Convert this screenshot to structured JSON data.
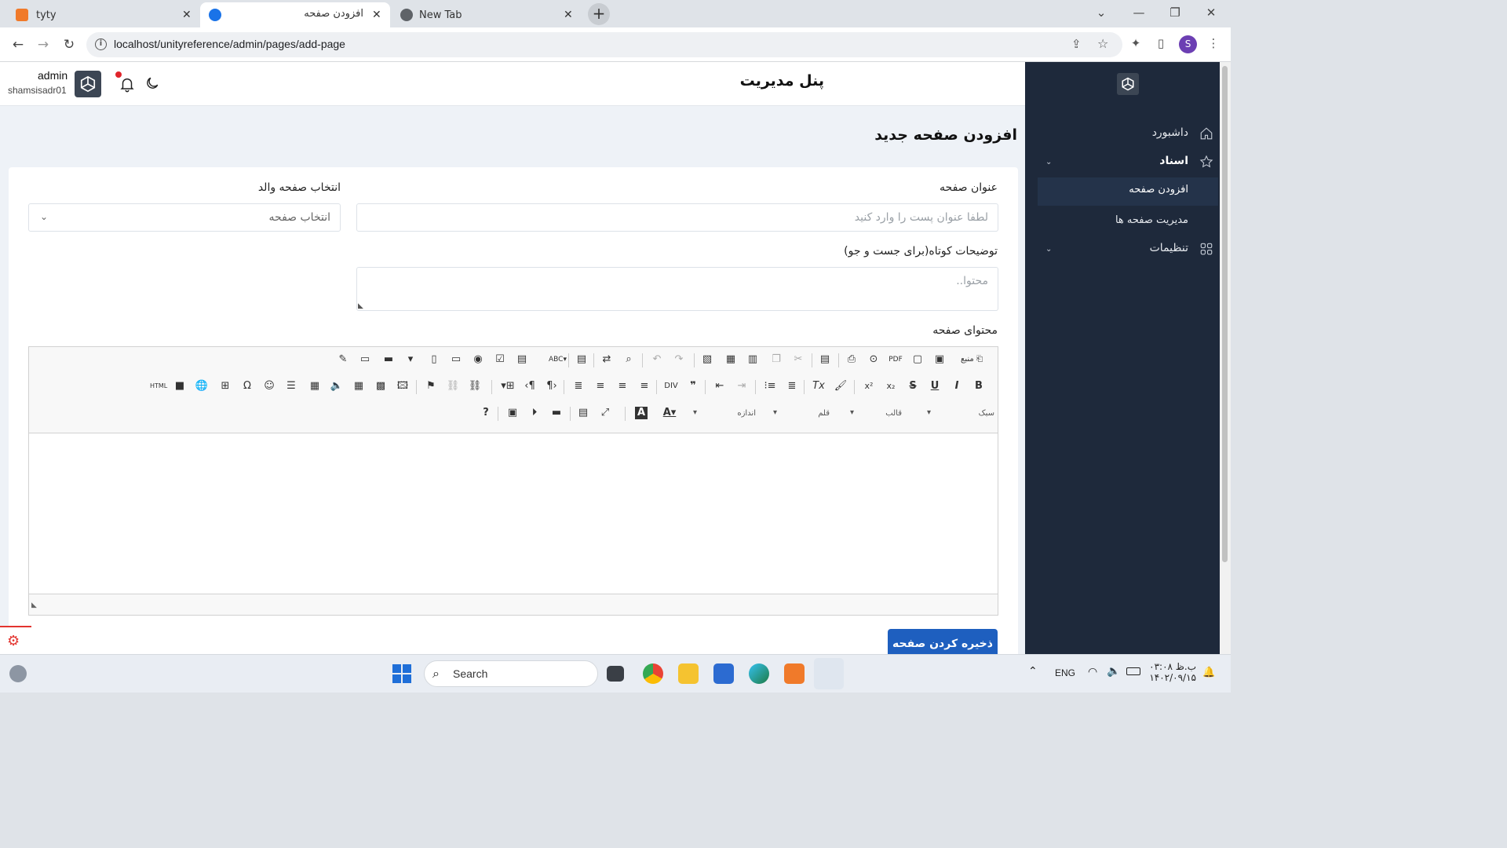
{
  "browser": {
    "tabs": [
      {
        "title": "tyty",
        "active": false
      },
      {
        "title": "افزودن صفحه",
        "active": true
      },
      {
        "title": "New Tab",
        "active": false
      }
    ],
    "url": "localhost/unityreference/admin/pages/add-page",
    "profile_initial": "S"
  },
  "header": {
    "panel_title": "پنل مدیریت",
    "user_name": "admin",
    "user_sub": "shamsisadr01"
  },
  "sidebar": {
    "items": [
      {
        "label": "داشبورد",
        "icon": "home-icon"
      },
      {
        "label": "اسناد",
        "icon": "star-icon",
        "expanded": true
      },
      {
        "label": "افزودن صفحه",
        "active": true
      },
      {
        "label": "مدیریت صفحه ها"
      },
      {
        "label": "تنظیمات",
        "icon": "grid-icon"
      }
    ]
  },
  "form": {
    "section_title": "افزودن صفحه جدید",
    "title_label": "عنوان صفحه",
    "title_placeholder": "لطفا عنوان پست را وارد کنید",
    "parent_label": "انتخاب صفحه والد",
    "parent_value": "انتخاب صفحه",
    "desc_label": "توضیحات کوتاه(برای جست و جو)",
    "desc_placeholder": "محتوا..",
    "content_label": "محتوای صفحه",
    "editor_source": "منبع",
    "editor_style": "سبک",
    "editor_format": "قالب",
    "editor_font": "قلم",
    "editor_size": "اندازه",
    "save_label": "ذخیره کردن صفحه"
  },
  "taskbar": {
    "search": "Search",
    "lang": "ENG",
    "time": "۰۳:۰۸ ب.ظ",
    "date": "۱۴۰۲/۰۹/۱۵"
  },
  "colors": {
    "sidebar_bg": "#1e293b",
    "accent": "#1e5fbf",
    "page_bg": "#eef2f7"
  }
}
